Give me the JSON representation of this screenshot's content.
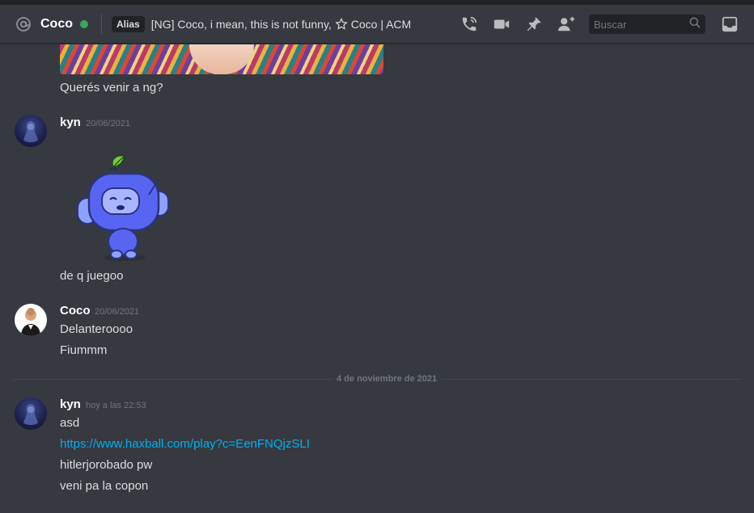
{
  "header": {
    "dm_name": "Coco",
    "alias_badge": "Alias",
    "alias_text_before": "[NG] Coco, i mean, this is not funny,",
    "alias_text_after": "Coco | ACM",
    "status_color": "#3ba55c",
    "icons": [
      "at-icon",
      "call-icon",
      "video-icon",
      "pin-icon",
      "add-friend-icon",
      "search-icon",
      "inbox-icon"
    ]
  },
  "search": {
    "placeholder": "Buscar"
  },
  "messages": {
    "prev_text": "Querés venir a ng?",
    "group1": {
      "author": "kyn",
      "timestamp": "20/06/2021",
      "sticker": "wumpus-sticker",
      "text": "de q juegoo"
    },
    "group2": {
      "author": "Coco",
      "timestamp": "20/06/2021",
      "lines": [
        "Delanteroooo",
        "Fiummm"
      ]
    },
    "date_divider": "4 de noviembre de 2021",
    "group3": {
      "author": "kyn",
      "timestamp": "hoy a las 22:53",
      "line1": "asd",
      "link": "https://www.haxball.com/play?c=EenFNQjzSLI",
      "line3": "hitlerjorobado pw",
      "line4": "veni pa la copon"
    }
  },
  "colors": {
    "background": "#36393f",
    "link": "#00aff4",
    "timestamp": "#72767d"
  }
}
